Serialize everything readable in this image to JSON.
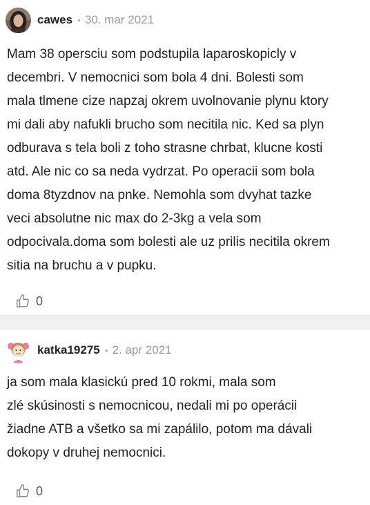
{
  "posts": [
    {
      "username": "cawes",
      "separator": "•",
      "date": "30. mar 2021",
      "body": "Mam 38 opersciu som podstupila laparoskopicly v\ndecembri. V nemocnici som bola 4 dni. Bolesti som\nmala tlmene cize napzaj okrem uvolnovanie plynu ktory\nmi dali aby nafukli brucho som necitila nic. Ked sa plyn\nodburava s tela boli z toho strasne chrbat, klucne kosti\natd. Ale nic co sa neda vydrzat. Po operacii som bola\ndoma 8tyzdnov na pnke. Nemohla som dvyhat tazke\nveci absolutne nic max do 2-3kg a vela som\nodpocivala.doma som bolesti ale uz prilis necitila okrem\nsitia na bruchu a v pupku.",
      "likes": "0",
      "avatar_icon": "user-photo-avatar",
      "like_icon": "thumbs-up-icon"
    },
    {
      "username": "katka19275",
      "separator": "•",
      "date": "2. apr 2021",
      "body": "ja som mala klasickú pred 10 rokmi, mala som\nzlé skúsinosti s nemocnicou, nedali mi po operácii\nžiadne ATB a všetko sa mi zapálilo, potom ma dávali\ndokopy v druhej nemocnici.",
      "likes": "0",
      "avatar_icon": "girl-cartoon-avatar",
      "like_icon": "thumbs-up-icon"
    }
  ],
  "colors": {
    "text": "#222222",
    "meta": "#9a9a9a",
    "divider": "#f1f1f1",
    "icon": "#8a8a8a"
  }
}
